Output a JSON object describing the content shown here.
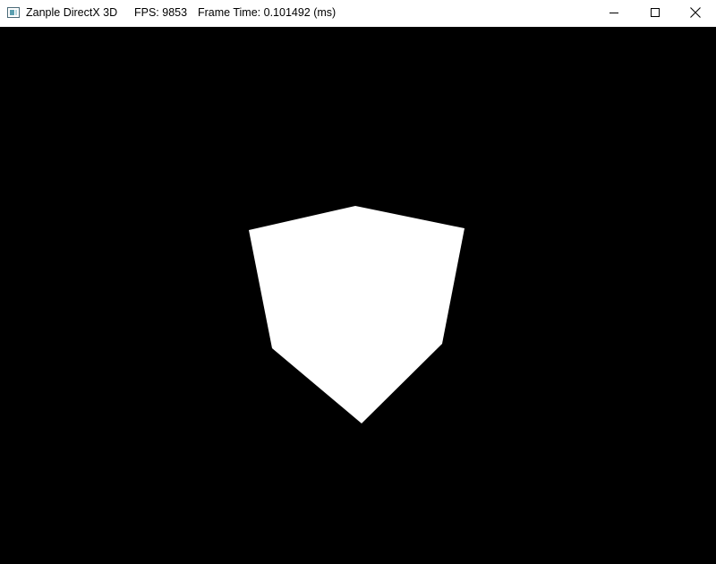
{
  "window": {
    "app_title": "Zanple DirectX 3D",
    "fps_text": "FPS: 9853",
    "frame_time_text": "Frame Time: 0.101492 (ms)"
  },
  "controls": {
    "minimize": "minimize",
    "maximize": "maximize",
    "close": "close"
  },
  "icons": {
    "app": "window-app-icon",
    "minimize": "minimize-icon",
    "maximize": "maximize-icon",
    "close": "close-icon"
  },
  "scene": {
    "background_color": "#000000",
    "object": "cube",
    "object_color": "#ffffff"
  }
}
